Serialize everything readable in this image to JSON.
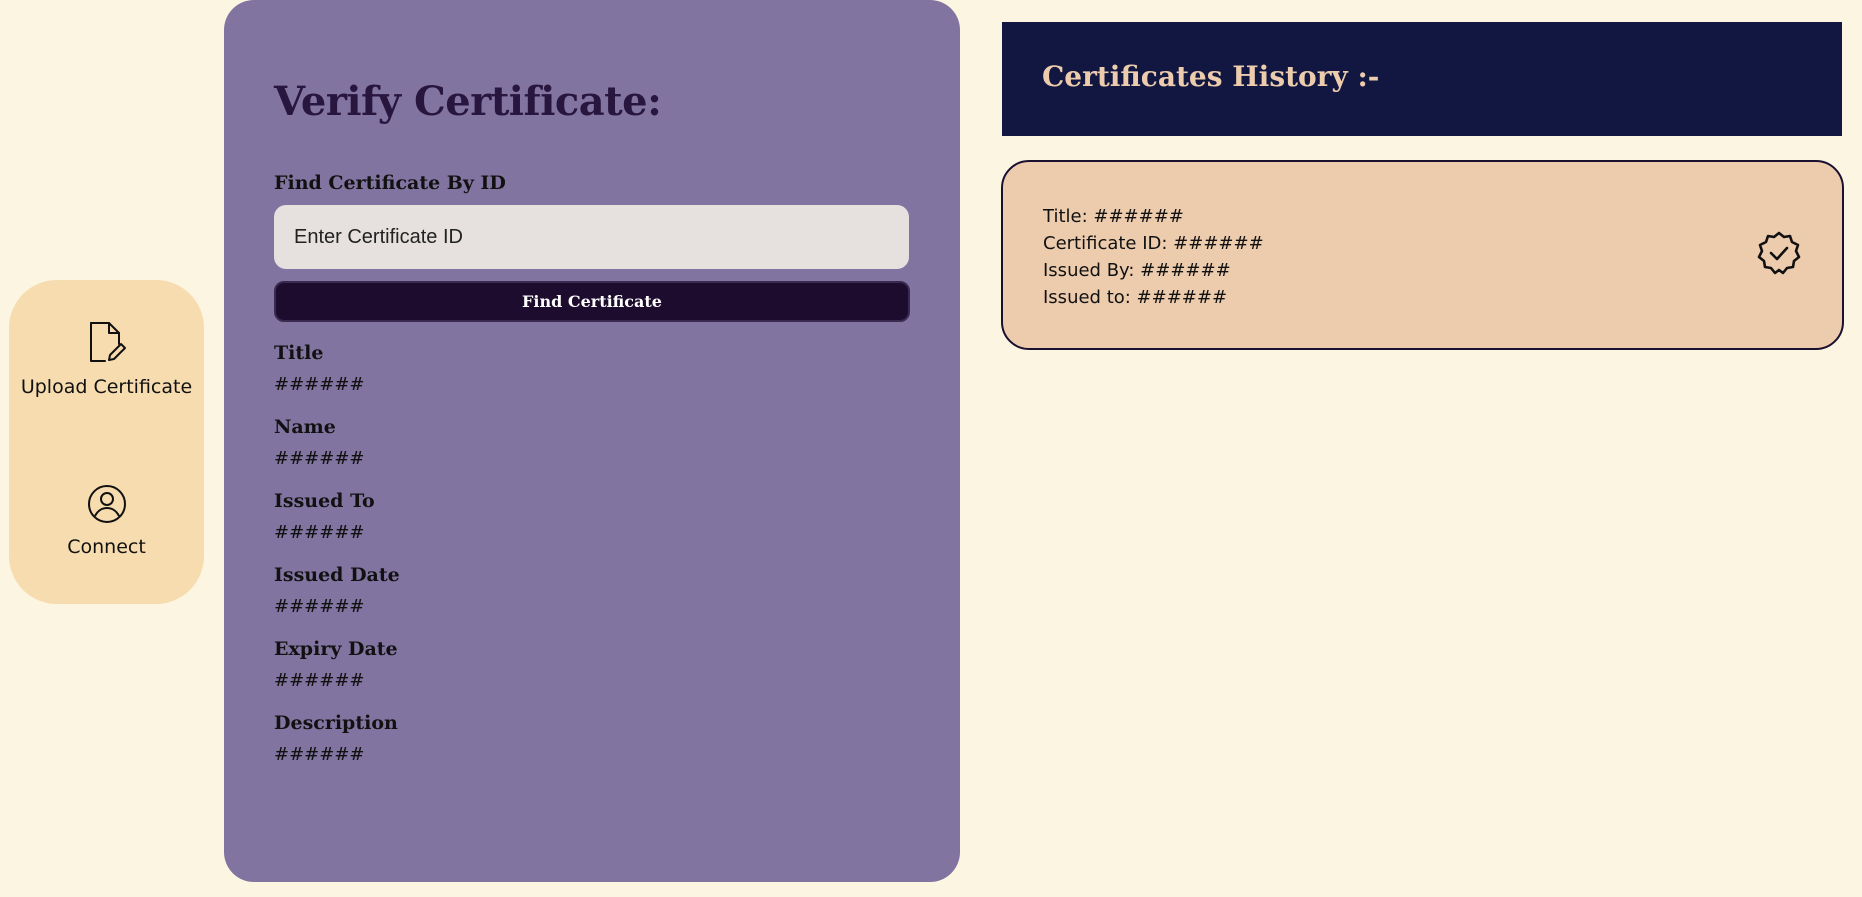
{
  "sidebar": {
    "items": [
      {
        "label": "Upload Certificate",
        "icon": "file-edit-icon"
      },
      {
        "label": "Connect",
        "icon": "user-circle-icon"
      }
    ]
  },
  "verify": {
    "title": "Verify Certificate:",
    "find_label": "Find Certificate By ID",
    "input": {
      "placeholder": "Enter Certificate ID",
      "value": ""
    },
    "button_label": "Find Certificate",
    "fields": [
      {
        "label": "Title",
        "value": "######"
      },
      {
        "label": "Name",
        "value": "######"
      },
      {
        "label": "Issued To",
        "value": "######"
      },
      {
        "label": "Issued Date",
        "value": "######"
      },
      {
        "label": "Expiry Date",
        "value": "######"
      },
      {
        "label": "Description",
        "value": "######"
      }
    ]
  },
  "history": {
    "title": "Certificates History :-",
    "cards": [
      {
        "lines": [
          "Title: ######",
          "Certificate ID: ######",
          "Issued By: ######",
          "Issued to: ######"
        ],
        "icon": "verified-badge-icon"
      }
    ]
  },
  "colors": {
    "background": "#fcf5e1",
    "sidebar": "#f6dcae",
    "verify_panel": "#8174a0",
    "button": "#1e0c2e",
    "history_header": "#111741",
    "history_title": "#ecccad",
    "card": "#edccae"
  }
}
